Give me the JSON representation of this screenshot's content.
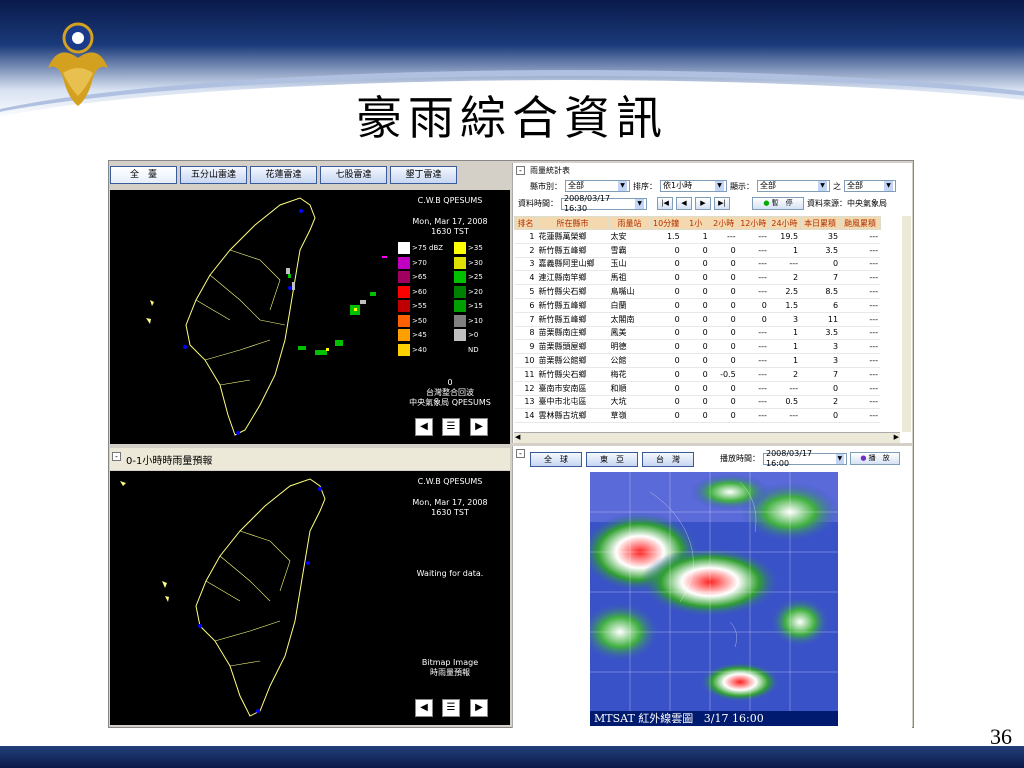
{
  "slide": {
    "title": "豪雨綜合資訊",
    "page_number": "36"
  },
  "radar": {
    "tabs": [
      "全　臺",
      "五分山雷達",
      "花蓮雷達",
      "七股雷達",
      "墾丁雷達"
    ],
    "source": "C.W.B QPESUMS",
    "datetime": "Mon, Mar 17, 2008",
    "time": "1630 TST",
    "legend_left": [
      ">75 dBZ",
      ">70",
      ">65",
      ">60",
      ">55",
      ">50",
      ">45",
      ">40"
    ],
    "legend_right": [
      ">35",
      ">30",
      ">25",
      ">20",
      ">15",
      ">10",
      ">0",
      "ND"
    ],
    "legend_left_colors": [
      "#ffffff",
      "#c000c0",
      "#a00060",
      "#ff0000",
      "#c00000",
      "#ff6000",
      "#ffa000",
      "#ffd000"
    ],
    "legend_right_colors": [
      "#ffff00",
      "#e0e000",
      "#00c000",
      "#008000",
      "#00a000",
      "#808080",
      "#c0c0c0",
      "#000000"
    ],
    "footer_line1": "0",
    "footer_line2": "台灣整合回波",
    "footer_line3": "中央氣象局 QPESUMS"
  },
  "forecast": {
    "title": "0-1小時時雨量預報",
    "source": "C.W.B QPESUMS",
    "datetime": "Mon, Mar 17, 2008",
    "time": "1630 TST",
    "status": "Waiting for data.",
    "footer_line1": "Bitmap Image",
    "footer_line2": "時雨量預報"
  },
  "stats": {
    "title": "雨量統計表",
    "county_label": "縣市別：",
    "county_value": "全部",
    "sort_label": "排序：",
    "sort_value": "依1小時",
    "display_label": "顯示：",
    "display_value": "全部",
    "of_label": "之",
    "of_value": "全部",
    "time_label": "資料時間：",
    "time_value": "2008/03/17 16:30",
    "pause_label": "暫　停",
    "source_label": "資料來源：中央氣象局",
    "columns": [
      "排名",
      "所在縣市",
      "雨量站",
      "10分鐘",
      "1小",
      "2小時",
      "12小時",
      "24小時",
      "本日累積",
      "颱風累積"
    ],
    "rows": [
      [
        "1",
        "花蓮縣萬榮鄉",
        "太安",
        "1.5",
        "1",
        "---",
        "---",
        "19.5",
        "35",
        "---"
      ],
      [
        "2",
        "新竹縣五峰鄉",
        "雪霸",
        "0",
        "0",
        "0",
        "---",
        "1",
        "3.5",
        "---"
      ],
      [
        "3",
        "嘉義縣阿里山鄉",
        "玉山",
        "0",
        "0",
        "0",
        "---",
        "---",
        "0",
        "---"
      ],
      [
        "4",
        "連江縣南竿鄉",
        "馬祖",
        "0",
        "0",
        "0",
        "---",
        "2",
        "7",
        "---"
      ],
      [
        "5",
        "新竹縣尖石鄉",
        "鳥嘴山",
        "0",
        "0",
        "0",
        "---",
        "2.5",
        "8.5",
        "---"
      ],
      [
        "6",
        "新竹縣五峰鄉",
        "白蘭",
        "0",
        "0",
        "0",
        "0",
        "1.5",
        "6",
        "---"
      ],
      [
        "7",
        "新竹縣五峰鄉",
        "太閣南",
        "0",
        "0",
        "0",
        "0",
        "3",
        "11",
        "---"
      ],
      [
        "8",
        "苗栗縣南庄鄉",
        "鳳美",
        "0",
        "0",
        "0",
        "---",
        "1",
        "3.5",
        "---"
      ],
      [
        "9",
        "苗栗縣頭屋鄉",
        "明德",
        "0",
        "0",
        "0",
        "---",
        "1",
        "3",
        "---"
      ],
      [
        "10",
        "苗栗縣公館鄉",
        "公館",
        "0",
        "0",
        "0",
        "---",
        "1",
        "3",
        "---"
      ],
      [
        "11",
        "新竹縣尖石鄉",
        "梅花",
        "0",
        "0",
        "-0.5",
        "---",
        "2",
        "7",
        "---"
      ],
      [
        "12",
        "臺南市安南區",
        "和順",
        "0",
        "0",
        "0",
        "---",
        "---",
        "0",
        "---"
      ],
      [
        "13",
        "臺中市北屯區",
        "大坑",
        "0",
        "0",
        "0",
        "---",
        "0.5",
        "2",
        "---"
      ],
      [
        "14",
        "雲林縣古坑鄉",
        "草嶺",
        "0",
        "0",
        "0",
        "---",
        "---",
        "0",
        "---"
      ]
    ]
  },
  "satellite": {
    "tabs": [
      "全　球",
      "東　亞",
      "台　灣"
    ],
    "play_time_label": "播放時間：",
    "play_time_value": "2008/03/17 16:00",
    "play_label": "播　放",
    "caption": "MTSAT 紅外線雲圖   3/17 16:00"
  }
}
